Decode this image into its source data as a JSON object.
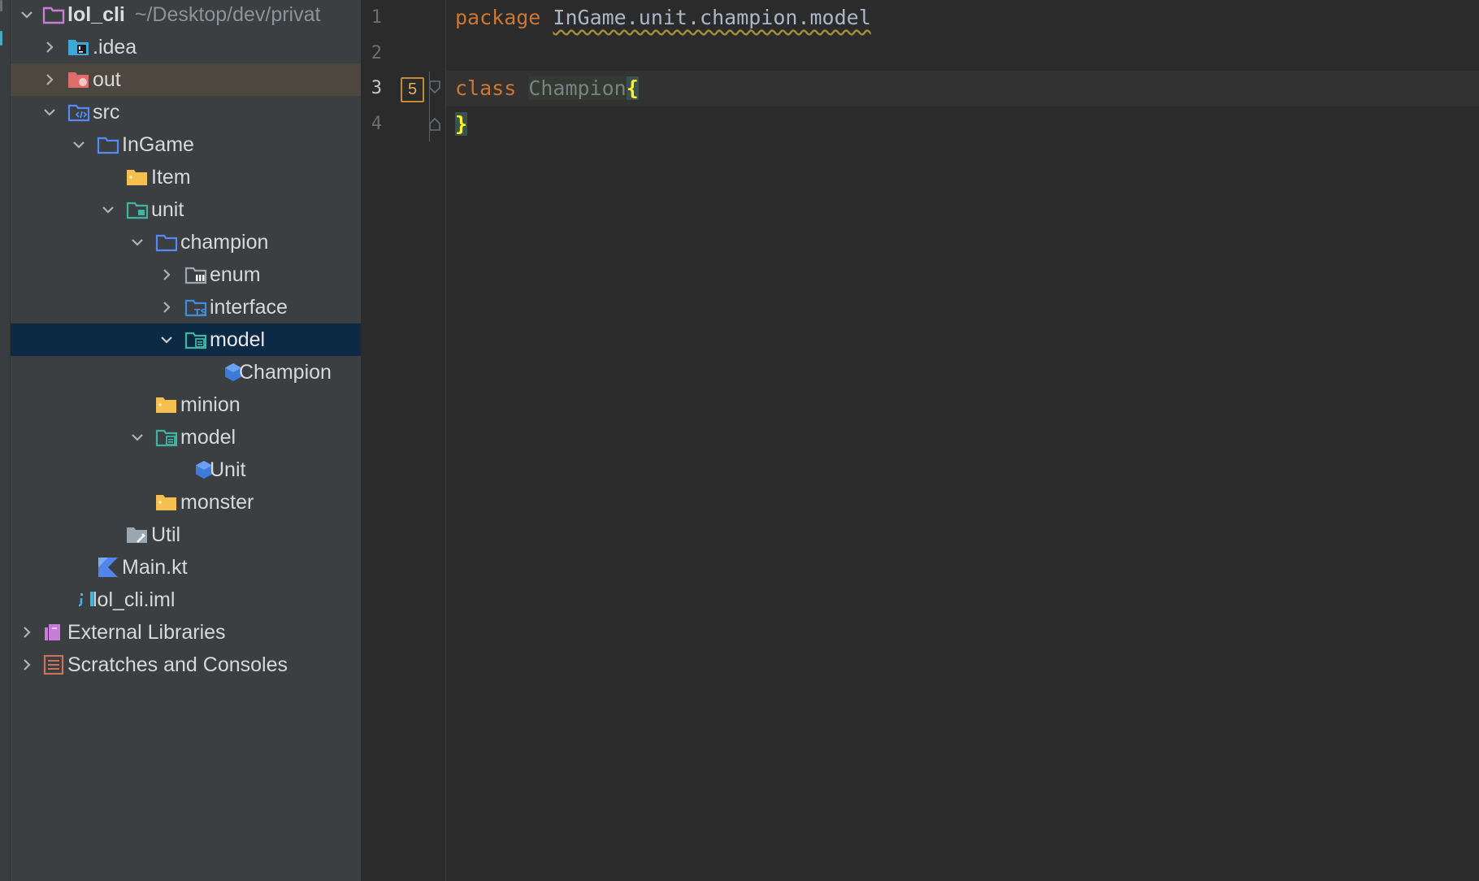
{
  "project_tree": {
    "root": {
      "name": "lol_cli",
      "path": "~/Desktop/dev/privat"
    },
    "items": [
      {
        "label": ".idea",
        "icon": "idea-folder-icon"
      },
      {
        "label": "out",
        "icon": "excluded-folder-icon"
      },
      {
        "label": "src",
        "icon": "source-folder-icon"
      },
      {
        "label": "InGame",
        "icon": "folder-icon"
      },
      {
        "label": "Item",
        "icon": "folder-icon"
      },
      {
        "label": "unit",
        "icon": "folder-icon"
      },
      {
        "label": "champion",
        "icon": "folder-icon"
      },
      {
        "label": "enum",
        "icon": "enum-folder-icon"
      },
      {
        "label": "interface",
        "icon": "interface-folder-icon"
      },
      {
        "label": "model",
        "icon": "model-folder-icon"
      },
      {
        "label": "Champion",
        "icon": "kotlin-class-icon"
      },
      {
        "label": "minion",
        "icon": "folder-icon"
      },
      {
        "label": "model",
        "icon": "model-folder-icon"
      },
      {
        "label": "Unit",
        "icon": "kotlin-class-icon"
      },
      {
        "label": "monster",
        "icon": "folder-icon"
      },
      {
        "label": "Util",
        "icon": "util-folder-icon"
      },
      {
        "label": "Main.kt",
        "icon": "kotlin-file-icon"
      },
      {
        "label": "lol_cli.iml",
        "icon": "iml-file-icon"
      },
      {
        "label": "External Libraries",
        "icon": "library-icon"
      },
      {
        "label": "Scratches and Consoles",
        "icon": "scratches-icon"
      }
    ]
  },
  "editor": {
    "line_numbers": [
      "1",
      "2",
      "3",
      "4"
    ],
    "line1": {
      "keyword": "package",
      "package_name": "InGame.unit.champion.model"
    },
    "line3": {
      "keyword": "class",
      "class_name": "Champion",
      "open_brace": "{"
    },
    "line4": {
      "close_brace": "}"
    },
    "usage_badge": "5"
  },
  "colors": {
    "panel_bg": "#3c3f41",
    "editor_bg": "#2b2b2b",
    "selection": "#0d2a44",
    "keyword": "#cc7832",
    "brace_highlight": "#ffef28"
  }
}
